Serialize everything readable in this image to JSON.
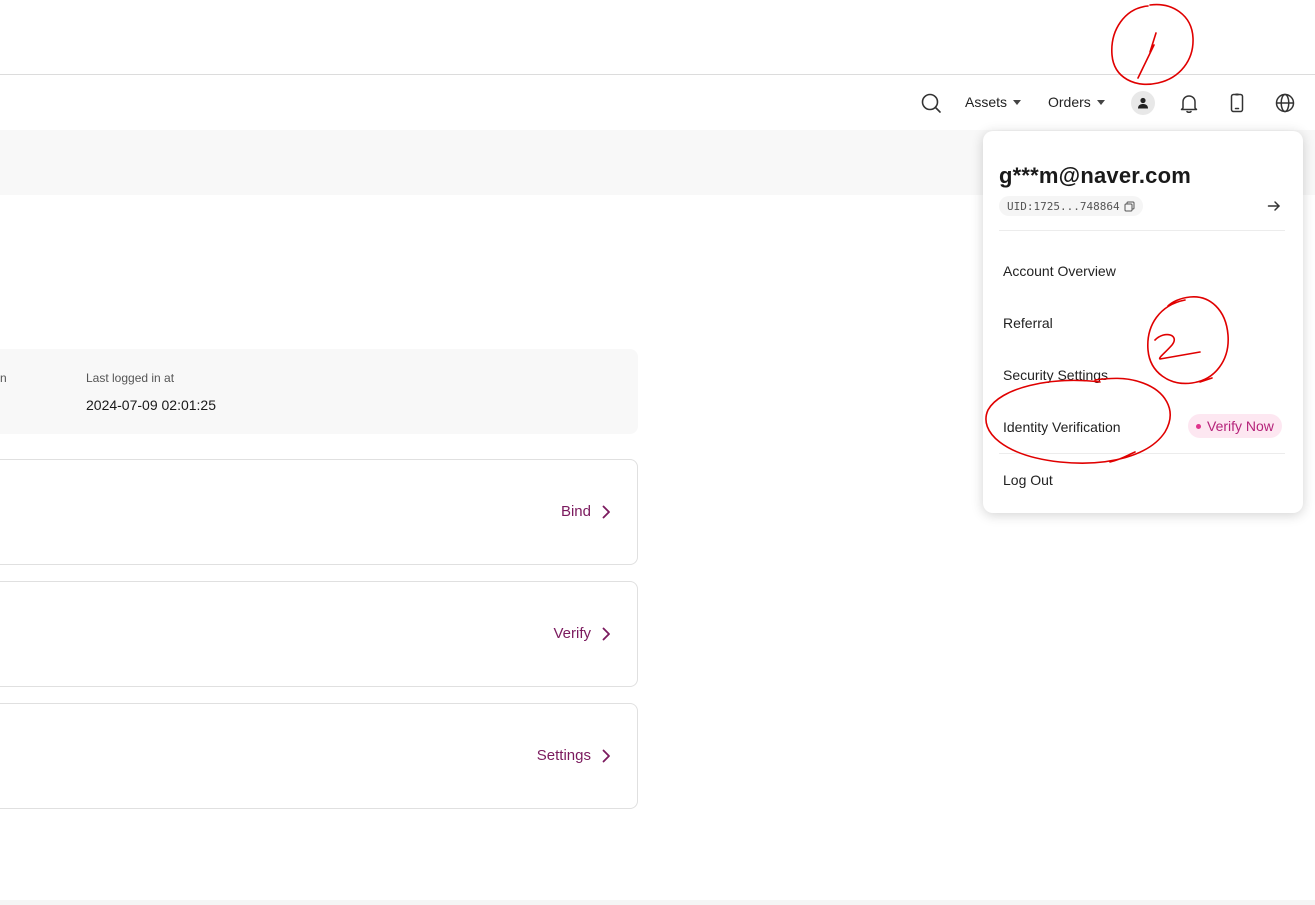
{
  "navbar": {
    "assets_label": "Assets",
    "orders_label": "Orders"
  },
  "login": {
    "cut_label": "n",
    "last_logged_label": "Last logged in at",
    "last_logged_value": "2024-07-09 02:01:25"
  },
  "cards": {
    "bind_label": "Bind",
    "verify_label": "Verify",
    "settings_label": "Settings"
  },
  "dropdown": {
    "email": "g***m@naver.com",
    "uid": "UID:1725...748864",
    "items": {
      "account_overview": "Account Overview",
      "referral": "Referral",
      "security_settings": "Security Settings",
      "identity_verification": "Identity Verification",
      "log_out": "Log Out"
    },
    "verify_badge": "Verify Now"
  },
  "colors": {
    "accent": "#7b1a5e",
    "badge_bg": "#fde7f1",
    "badge_text": "#b5237a",
    "annotation": "#e00000"
  },
  "icons": [
    "search-icon",
    "caret-down-icon",
    "user-icon",
    "bell-icon",
    "phone-icon",
    "globe-icon",
    "copy-icon",
    "arrow-right-icon",
    "chevron-right-icon"
  ]
}
